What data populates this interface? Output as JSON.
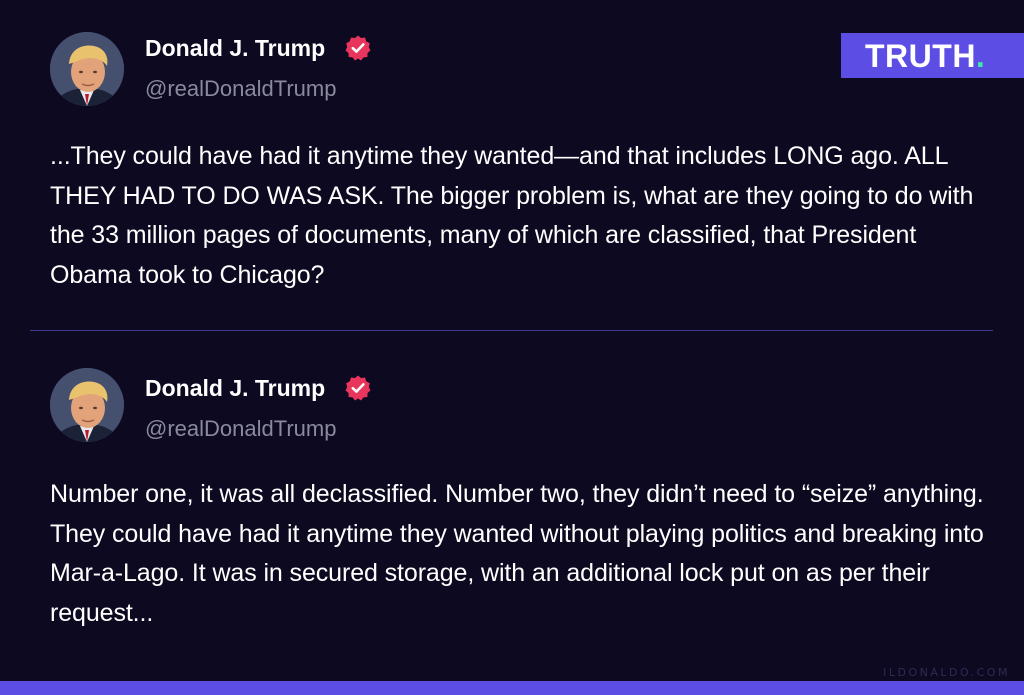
{
  "brand": {
    "name": "TRUTH",
    "dot": ".",
    "color": "#5c4ee5",
    "dot_color": "#3ee6a8"
  },
  "posts": [
    {
      "author": "Donald J. Trump",
      "handle": "@realDonaldTrump",
      "verified": true,
      "verified_color": "#e8355c",
      "text": "...They could have had it anytime they wanted—and that includes LONG ago. ALL THEY HAD TO DO WAS ASK. The bigger problem is, what are they going to do with the 33 million pages of documents, many of which are classified, that President Obama took to Chicago?"
    },
    {
      "author": "Donald J. Trump",
      "handle": "@realDonaldTrump",
      "verified": true,
      "verified_color": "#e8355c",
      "text": "Number one, it was all declassified. Number two, they didn’t need to “seize” anything. They could have had it anytime they wanted without playing politics and breaking into Mar-a-Lago. It was in secured storage, with an additional lock put on as per their request..."
    }
  ],
  "footer": {
    "watermark": "ILDONALDO.COM"
  }
}
